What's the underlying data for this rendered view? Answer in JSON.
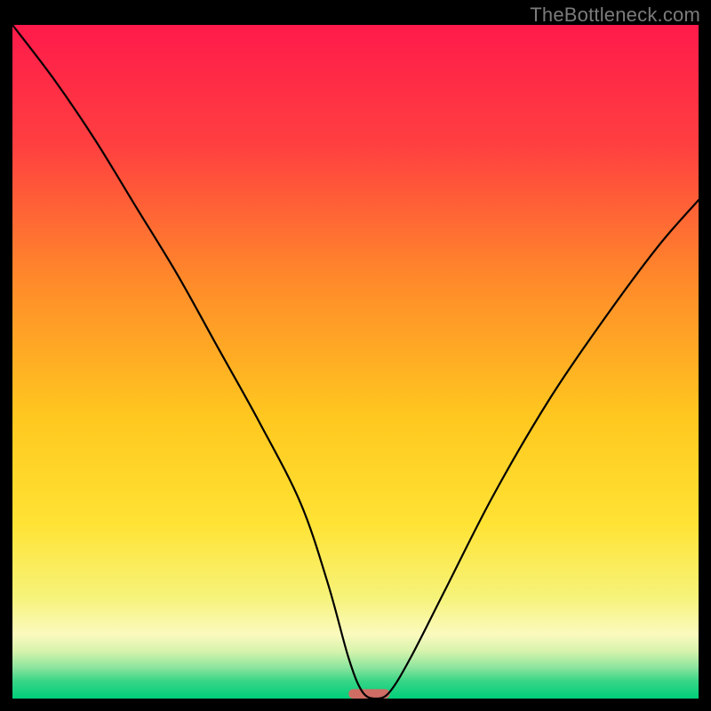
{
  "watermark": "TheBottleneck.com",
  "chart_data": {
    "type": "line",
    "title": "",
    "xlabel": "",
    "ylabel": "",
    "xlim": [
      0,
      100
    ],
    "ylim": [
      0,
      100
    ],
    "grid": false,
    "legend": false,
    "background_gradient": {
      "stops": [
        {
          "t": 0.0,
          "color": "#ff1a4b"
        },
        {
          "t": 0.18,
          "color": "#ff4040"
        },
        {
          "t": 0.38,
          "color": "#ff8a2a"
        },
        {
          "t": 0.58,
          "color": "#ffc71f"
        },
        {
          "t": 0.74,
          "color": "#ffe334"
        },
        {
          "t": 0.85,
          "color": "#f6f37a"
        },
        {
          "t": 0.905,
          "color": "#fbfabe"
        },
        {
          "t": 0.93,
          "color": "#d6f3ac"
        },
        {
          "t": 0.955,
          "color": "#88e49d"
        },
        {
          "t": 0.975,
          "color": "#35d585"
        },
        {
          "t": 1.0,
          "color": "#00cf7a"
        }
      ]
    },
    "series": [
      {
        "name": "bottleneck-curve",
        "x": [
          0,
          6,
          12,
          18,
          24,
          30,
          36,
          42,
          46,
          49,
          51,
          53,
          55,
          58,
          63,
          70,
          78,
          86,
          94,
          100
        ],
        "y": [
          100,
          92,
          83,
          73,
          63,
          52,
          41,
          29,
          17,
          6,
          1,
          0,
          1,
          6,
          16,
          30,
          44,
          56,
          67,
          74
        ]
      }
    ],
    "marker": {
      "name": "optimal-point",
      "x": 52,
      "y": 0,
      "width": 6,
      "height": 1.4,
      "color": "#cf6d65",
      "shape": "rounded-bar"
    }
  }
}
